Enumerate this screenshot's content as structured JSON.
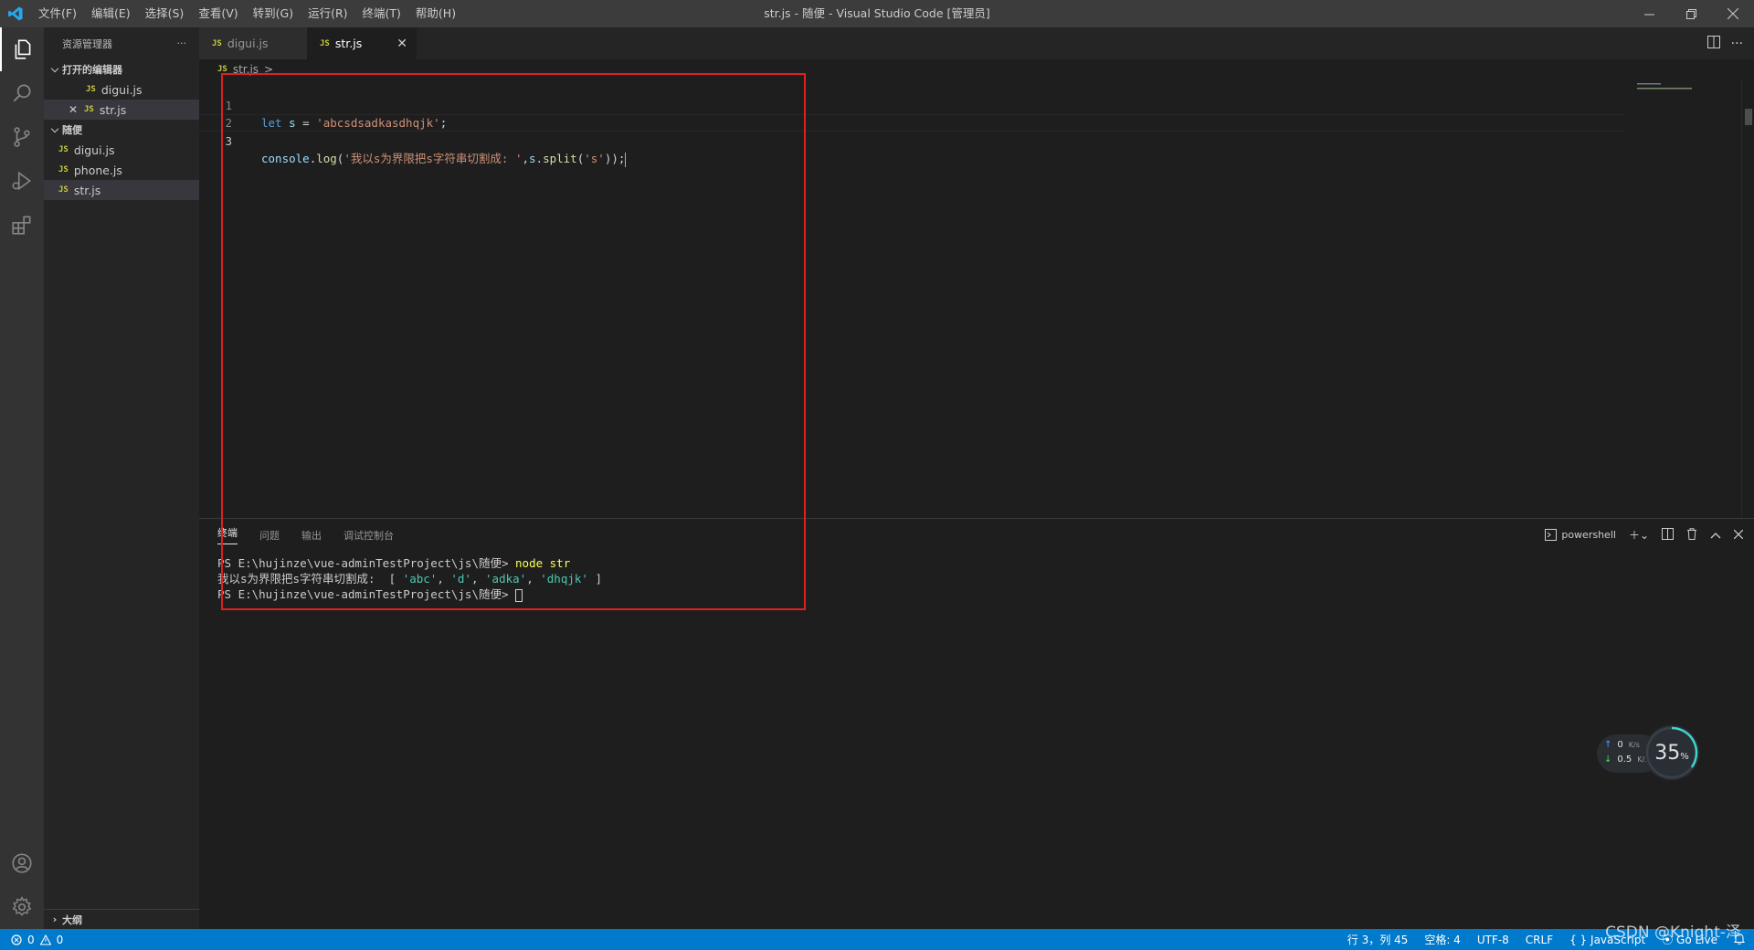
{
  "titlebar": {
    "menu": [
      "文件(F)",
      "编辑(E)",
      "选择(S)",
      "查看(V)",
      "转到(G)",
      "运行(R)",
      "终端(T)",
      "帮助(H)"
    ],
    "title": "str.js - 随便 - Visual Studio Code [管理员]"
  },
  "sidebar": {
    "header": "资源管理器",
    "more": "···",
    "open_editors_label": "打开的编辑器",
    "open_editors": [
      {
        "badge": "JS",
        "name": "digui.js"
      },
      {
        "badge": "JS",
        "name": "str.js"
      }
    ],
    "folder_label": "随便",
    "files": [
      {
        "badge": "JS",
        "name": "digui.js"
      },
      {
        "badge": "JS",
        "name": "phone.js"
      },
      {
        "badge": "JS",
        "name": "str.js"
      }
    ],
    "outline_label": "大纲"
  },
  "tabs": [
    {
      "badge": "JS",
      "name": "digui.js"
    },
    {
      "badge": "JS",
      "name": "str.js"
    }
  ],
  "breadcrumb": {
    "badge": "JS",
    "file": "str.js",
    "sep": ">"
  },
  "editor": {
    "lines": [
      {
        "num": "1",
        "tokens": {
          "kw": "let",
          "var": " s",
          "op": " = ",
          "str": "'abcsdsadkasdhqjk'",
          "end": ";"
        }
      },
      {
        "num": "2"
      },
      {
        "num": "3",
        "tokens": {
          "obj": "console",
          "dot": ".",
          "fn": "log",
          "open": "(",
          "str": "'我以s为界限把s字符串切割成: '",
          "comma": ",",
          "var": "s",
          "dot2": ".",
          "fn2": "split",
          "open2": "(",
          "str2": "'s'",
          "close": "));"
        }
      }
    ]
  },
  "panel": {
    "tabs": [
      "终端",
      "问题",
      "输出",
      "调试控制台"
    ],
    "shell": "powershell",
    "terminal": {
      "line1_prompt": "PS E:\\hujinze\\vue-adminTestProject\\js\\随便> ",
      "line1_cmd": "node str",
      "line2_text": "我以s为界限把s字符串切割成:  [ ",
      "line2_items": [
        "'abc'",
        "'d'",
        "'adka'",
        "'dhqjk'"
      ],
      "line2_end": " ]",
      "line3_prompt": "PS E:\\hujinze\\vue-adminTestProject\\js\\随便> "
    }
  },
  "netmon": {
    "up": "0",
    "down": "0.5",
    "unit": "K/s",
    "percent": "35",
    "percent_unit": "%"
  },
  "statusbar": {
    "errors": "0",
    "warnings": "0",
    "position": "行 3，列 45",
    "spaces": "空格: 4",
    "encoding": "UTF-8",
    "eol": "CRLF",
    "language": "JavaScript",
    "golive": "Go Live"
  },
  "watermark": "CSDN @Knight-泽",
  "colors": {
    "accent": "#007acc",
    "annotation": "#e02020",
    "titlebar": "#3c3c3c"
  }
}
